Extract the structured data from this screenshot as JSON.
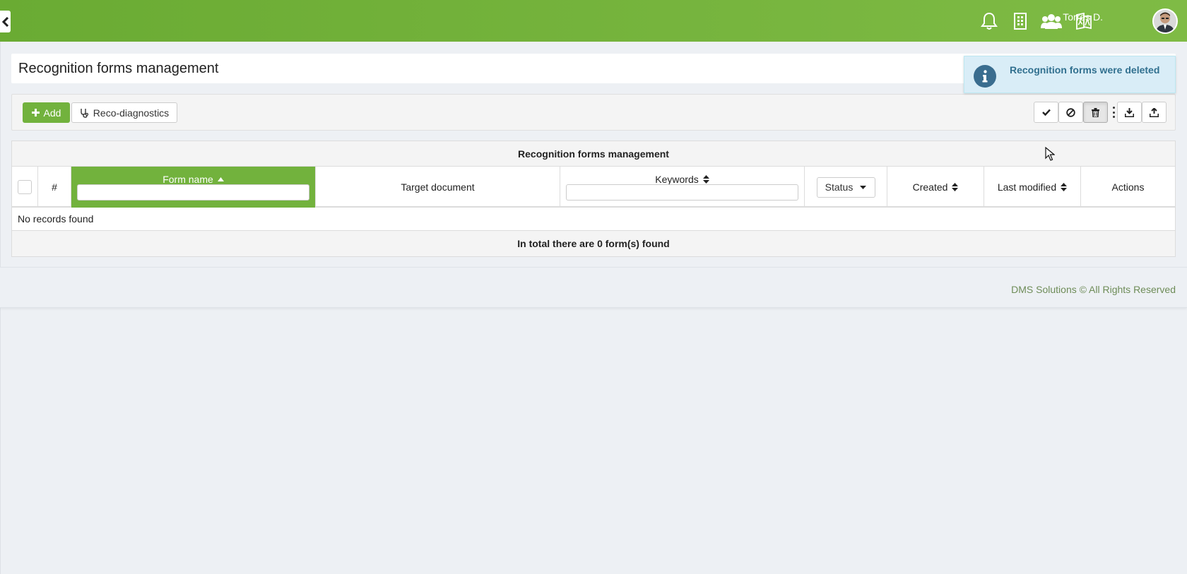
{
  "header": {
    "user_name": "Torres D.",
    "icons": [
      "bell-icon",
      "building-icon",
      "users-icon",
      "language-icon"
    ],
    "accent": "#72b23d"
  },
  "page": {
    "title": "Recognition forms management"
  },
  "toast": {
    "message": "Recognition forms were deleted",
    "icon": "info-icon"
  },
  "toolbar": {
    "add_label": "Add",
    "reco_label": "Reco-diagnostics",
    "actions": [
      "check-icon",
      "ban-icon",
      "trash-icon",
      "kebab-icon",
      "download-icon",
      "upload-icon"
    ]
  },
  "table": {
    "caption": "Recognition forms management",
    "columns": {
      "number": "#",
      "form_name": "Form name",
      "target_document": "Target document",
      "keywords": "Keywords",
      "status": "Status",
      "created": "Created",
      "last_modified": "Last modified",
      "actions": "Actions"
    },
    "empty_text": "No records found",
    "footer": "In total there are 0 form(s) found"
  },
  "footer": {
    "text": "DMS Solutions © All Rights Reserved"
  }
}
